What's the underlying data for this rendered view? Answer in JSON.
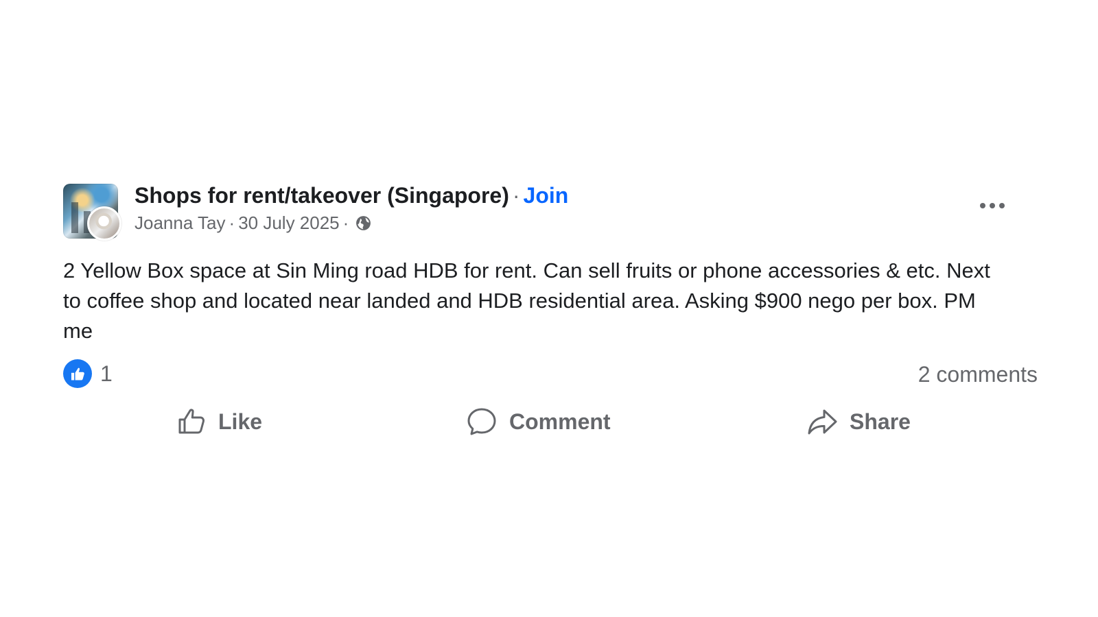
{
  "post": {
    "group_name": "Shops for rent/takeover (Singapore)",
    "separator": "·",
    "join_label": "Join",
    "author": "Joanna Tay",
    "date": "30 July 2025",
    "body": "2 Yellow Box space at Sin Ming road HDB for rent. Can sell fruits or phone accessories & etc. Next to coffee shop and located near landed and HDB residential area. Asking $900 nego per box. PM me",
    "visibility_icon": "globe-icon",
    "reactions": {
      "icon": "thumbs-up-icon",
      "count": "1"
    },
    "comments_label": "2 comments",
    "actions": {
      "like": "Like",
      "comment": "Comment",
      "share": "Share"
    },
    "colors": {
      "accent_blue": "#0866ff",
      "reaction_blue": "#1877f2",
      "secondary_text": "#65676b",
      "primary_text": "#1c1e21"
    }
  }
}
